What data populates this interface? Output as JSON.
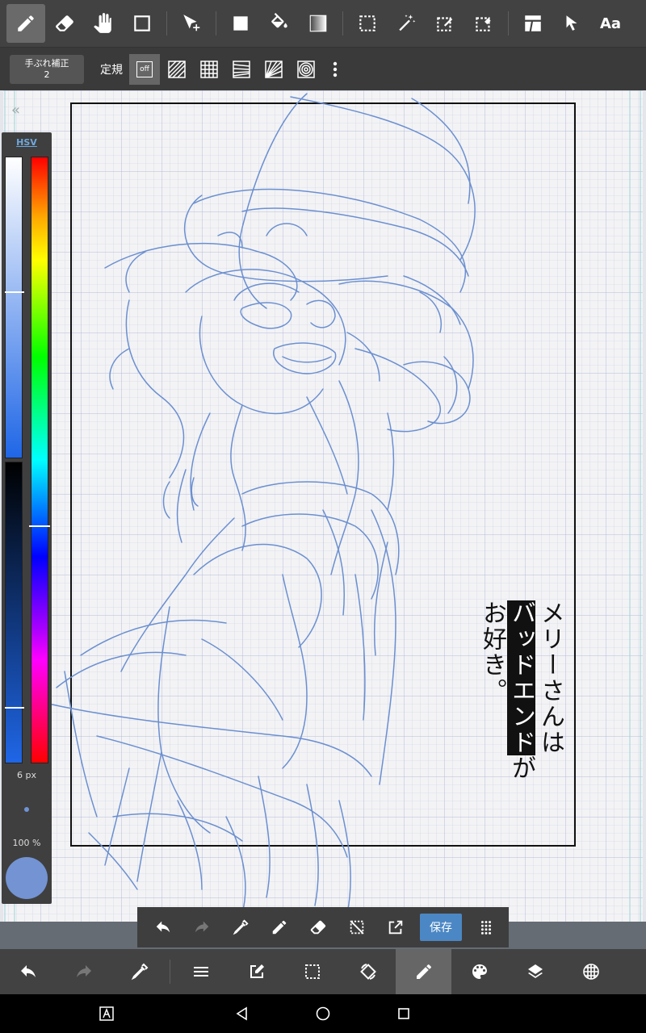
{
  "toolbar": {
    "items": [
      "pen",
      "eraser",
      "hand",
      "shape",
      "move",
      "fill-rect",
      "bucket",
      "gradient",
      "select-rect",
      "magic-wand",
      "select-pen",
      "select-eraser",
      "panel",
      "pointer"
    ],
    "text_tool_label": "Aa"
  },
  "sub_toolbar": {
    "stabilizer_label": "手ぶれ補正",
    "stabilizer_value": "2",
    "ruler_label": "定規",
    "ruler_off": "off"
  },
  "color_panel": {
    "mode_tab": "HSV",
    "brush_size": "6 px",
    "opacity": "100 %",
    "current_color": "#7393d3"
  },
  "title_text": {
    "col1": "メリーさんは",
    "col2_inverted": "バッドエンド",
    "col2_tail": "が",
    "col3": "お好き。"
  },
  "float_toolbar": {
    "save_label": "保存"
  },
  "colors": {
    "sketch_line": "#6b8fd0",
    "accent": "#4b87c4"
  }
}
